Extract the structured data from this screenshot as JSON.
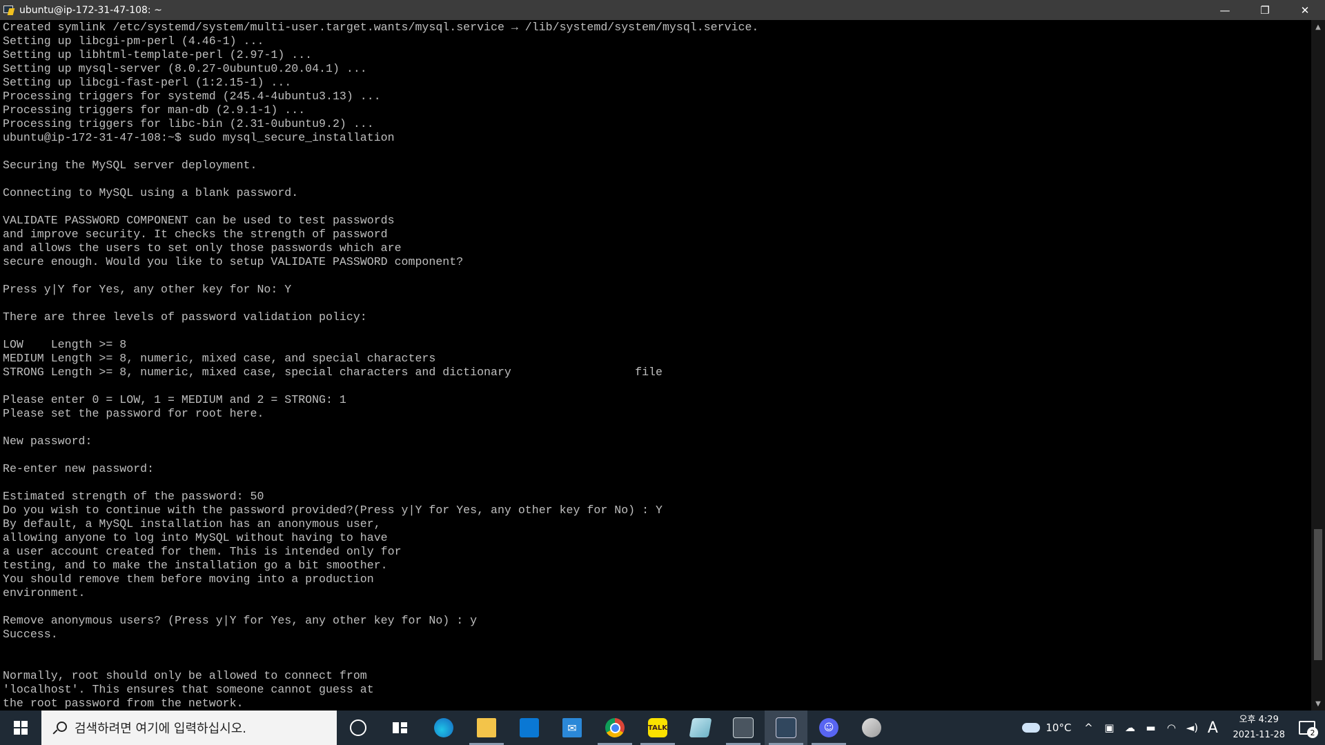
{
  "window": {
    "title": "ubuntu@ip-172-31-47-108: ~",
    "controls": {
      "minimize": "—",
      "restore": "❐",
      "close": "✕"
    }
  },
  "terminal": {
    "lines": [
      "Created symlink /etc/systemd/system/multi-user.target.wants/mysql.service → /lib/systemd/system/mysql.service.",
      "Setting up libcgi-pm-perl (4.46-1) ...",
      "Setting up libhtml-template-perl (2.97-1) ...",
      "Setting up mysql-server (8.0.27-0ubuntu0.20.04.1) ...",
      "Setting up libcgi-fast-perl (1:2.15-1) ...",
      "Processing triggers for systemd (245.4-4ubuntu3.13) ...",
      "Processing triggers for man-db (2.9.1-1) ...",
      "Processing triggers for libc-bin (2.31-0ubuntu9.2) ...",
      "ubuntu@ip-172-31-47-108:~$ sudo mysql_secure_installation",
      "",
      "Securing the MySQL server deployment.",
      "",
      "Connecting to MySQL using a blank password.",
      "",
      "VALIDATE PASSWORD COMPONENT can be used to test passwords",
      "and improve security. It checks the strength of password",
      "and allows the users to set only those passwords which are",
      "secure enough. Would you like to setup VALIDATE PASSWORD component?",
      "",
      "Press y|Y for Yes, any other key for No: Y",
      "",
      "There are three levels of password validation policy:",
      "",
      "LOW    Length >= 8",
      "MEDIUM Length >= 8, numeric, mixed case, and special characters",
      "STRONG Length >= 8, numeric, mixed case, special characters and dictionary                  file",
      "",
      "Please enter 0 = LOW, 1 = MEDIUM and 2 = STRONG: 1",
      "Please set the password for root here.",
      "",
      "New password:",
      "",
      "Re-enter new password:",
      "",
      "Estimated strength of the password: 50",
      "Do you wish to continue with the password provided?(Press y|Y for Yes, any other key for No) : Y",
      "By default, a MySQL installation has an anonymous user,",
      "allowing anyone to log into MySQL without having to have",
      "a user account created for them. This is intended only for",
      "testing, and to make the installation go a bit smoother.",
      "You should remove them before moving into a production",
      "environment.",
      "",
      "Remove anonymous users? (Press y|Y for Yes, any other key for No) : y",
      "Success.",
      "",
      "",
      "Normally, root should only be allowed to connect from",
      "'localhost'. This ensures that someone cannot guess at",
      "the root password from the network."
    ]
  },
  "taskbar": {
    "search_placeholder": "검색하려면 여기에 입력하십시오.",
    "talk_label": "TALK",
    "weather": "10°C",
    "ime": "A",
    "clock_time": "오후 4:29",
    "clock_date": "2021-11-28",
    "notification_count": "2",
    "tray_overflow": "^"
  }
}
